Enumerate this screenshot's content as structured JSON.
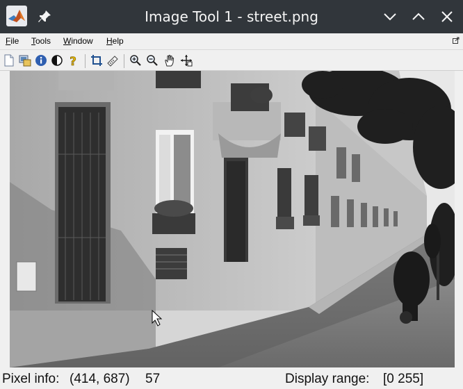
{
  "window": {
    "title": "Image Tool 1 - street.png"
  },
  "menubar": {
    "items": [
      {
        "label": "File"
      },
      {
        "label": "Tools"
      },
      {
        "label": "Window"
      },
      {
        "label": "Help"
      }
    ]
  },
  "toolbar": {
    "groups": [
      [
        "new-figure-icon",
        "export-icon",
        "image-info-icon",
        "contrast-icon",
        "help-icon"
      ],
      [
        "crop-icon",
        "measure-distance-icon"
      ],
      [
        "zoom-in-icon",
        "zoom-out-icon",
        "pan-hand-icon",
        "overview-icon"
      ]
    ]
  },
  "image": {
    "filename": "street.png",
    "colormap": "grayscale"
  },
  "status": {
    "pixel_info_label": "Pixel info:",
    "pixel_info_coords": "(414, 687)",
    "pixel_info_value": "57",
    "display_range_label": "Display range:",
    "display_range_value": "[0 255]"
  },
  "colors": {
    "titlebar": "#31363b",
    "window_bg": "#f0f0f0"
  }
}
